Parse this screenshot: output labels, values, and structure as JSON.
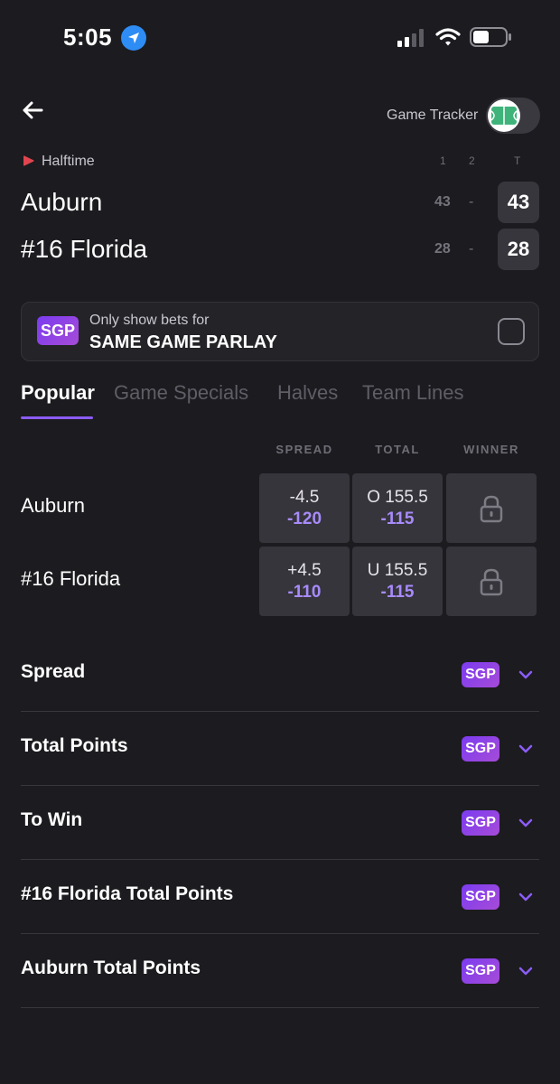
{
  "status_bar": {
    "time": "5:05"
  },
  "header": {
    "game_tracker_label": "Game Tracker"
  },
  "scoreboard": {
    "status": "Halftime",
    "period_headers": [
      "1",
      "2",
      "T"
    ],
    "teams": [
      {
        "name": "Auburn",
        "q1": "43",
        "q2": "-",
        "total": "43"
      },
      {
        "name": "#16 Florida",
        "q1": "28",
        "q2": "-",
        "total": "28"
      }
    ]
  },
  "sgp_banner": {
    "badge": "SGP",
    "line1": "Only show bets for",
    "line2": "SAME GAME PARLAY"
  },
  "tabs": [
    "Popular",
    "Game Specials",
    "Halves",
    "Team Lines"
  ],
  "odds": {
    "headers": [
      "SPREAD",
      "TOTAL",
      "WINNER"
    ],
    "rows": [
      {
        "team": "Auburn",
        "spread_line": "-4.5",
        "spread_price": "-120",
        "total_line": "O 155.5",
        "total_price": "-115"
      },
      {
        "team": "#16 Florida",
        "spread_line": "+4.5",
        "spread_price": "-110",
        "total_line": "U 155.5",
        "total_price": "-115"
      }
    ]
  },
  "markets": [
    {
      "label": "Spread",
      "badge": "SGP"
    },
    {
      "label": "Total Points",
      "badge": "SGP"
    },
    {
      "label": "To Win",
      "badge": "SGP"
    },
    {
      "label": "#16 Florida Total Points",
      "badge": "SGP"
    },
    {
      "label": "Auburn Total Points",
      "badge": "SGP"
    }
  ],
  "colors": {
    "background": "#1c1b1f",
    "accent": "#8b5cf6",
    "price": "#a78bfa",
    "live": "#e0454f"
  }
}
